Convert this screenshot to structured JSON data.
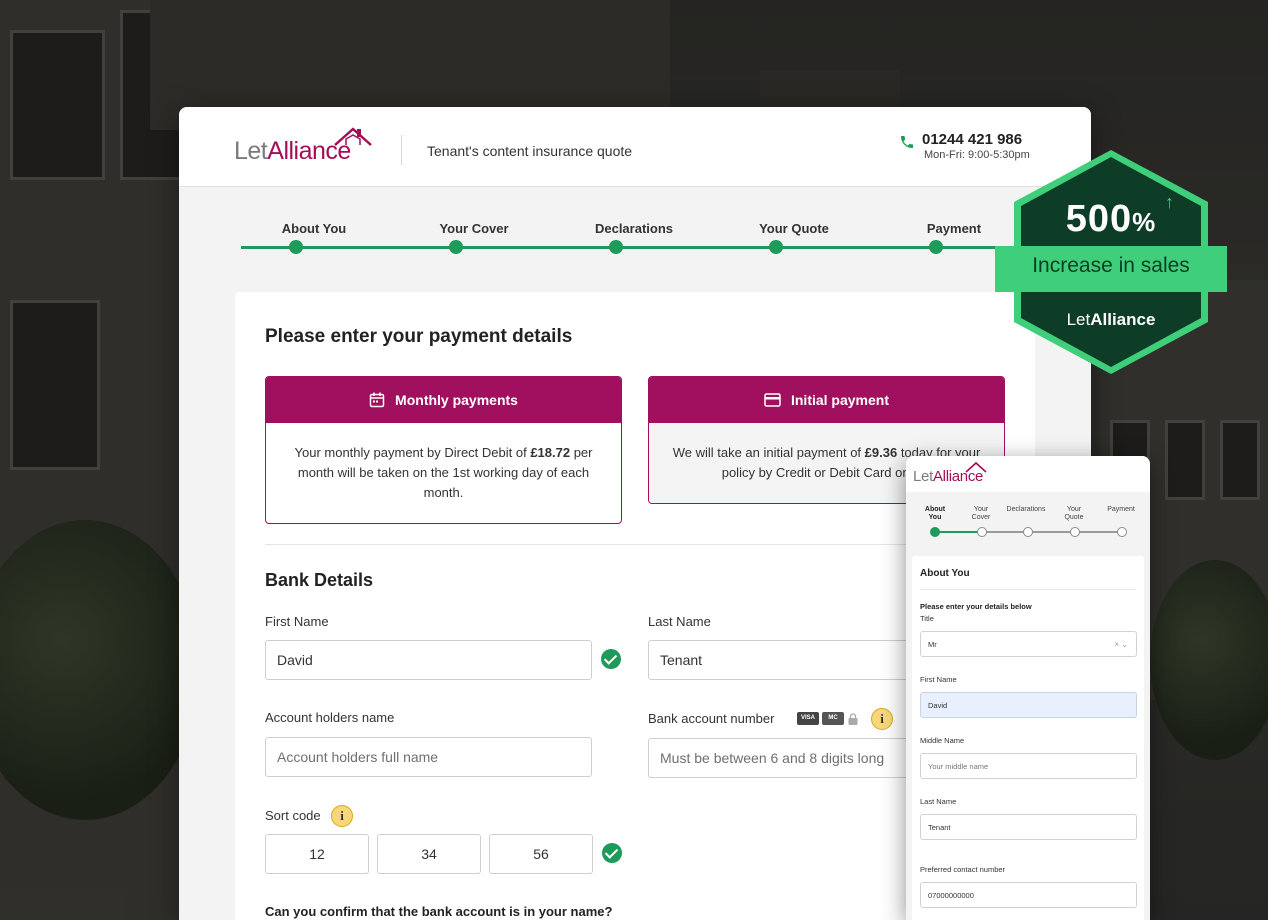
{
  "colors": {
    "brand": "#a0105e",
    "success": "#1e9a5a",
    "badge_dark": "#0e3d27",
    "badge_light": "#3fcf7a"
  },
  "header": {
    "logo_let": "Let",
    "logo_alliance": "Alliance",
    "title": "Tenant's content insurance quote",
    "phone": "01244 421 986",
    "hours": "Mon-Fri: 9:00-5:30pm"
  },
  "steps": [
    "About You",
    "Your Cover",
    "Declarations",
    "Your Quote",
    "Payment"
  ],
  "payment": {
    "heading": "Please enter your payment details",
    "monthly": {
      "title": "Monthly payments",
      "text_a": "Your monthly payment by Direct Debit of ",
      "amount": "£18.72",
      "text_b": " per month will be taken on the 1st working day of each month."
    },
    "initial": {
      "title": "Initial payment",
      "text_a": "We will take an initial payment of ",
      "amount": "£9.36",
      "text_b": " today for your policy by Credit or Debit Card on the"
    }
  },
  "bank": {
    "heading": "Bank Details",
    "first_name_label": "First Name",
    "first_name_value": "David",
    "last_name_label": "Last Name",
    "last_name_value": "Tenant",
    "account_holder_label": "Account holders name",
    "account_holder_placeholder": "Account holders full name",
    "account_number_label": "Bank account number",
    "account_number_placeholder": "Must be between 6 and 8 digits long",
    "card_icons": [
      "VISA",
      "MC"
    ],
    "sort_code_label": "Sort code",
    "sort_code": [
      "12",
      "34",
      "56"
    ],
    "confirm_question": "Can you confirm that the bank account is in your name?"
  },
  "badge": {
    "value": "500",
    "unit": "%",
    "arrow": "↑",
    "text": "Increase in sales",
    "logo_let": "Let",
    "logo_alliance": "Alliance"
  },
  "mobile": {
    "logo_let": "Let",
    "logo_alliance": "Alliance",
    "steps": [
      "About\nYou",
      "Your\nCover",
      "Declarations",
      "Your\nQuote",
      "Payment"
    ],
    "section_title": "About You",
    "subtitle": "Please enter your details below",
    "title_label": "Title",
    "title_value": "Mr",
    "title_clear": "× ⌄",
    "first_name_label": "First Name",
    "first_name_value": "David",
    "middle_name_label": "Middle Name",
    "middle_name_placeholder": "Your middle name",
    "last_name_label": "Last Name",
    "last_name_value": "Tenant",
    "contact_label": "Preferred contact number",
    "contact_value": "07000000000"
  }
}
